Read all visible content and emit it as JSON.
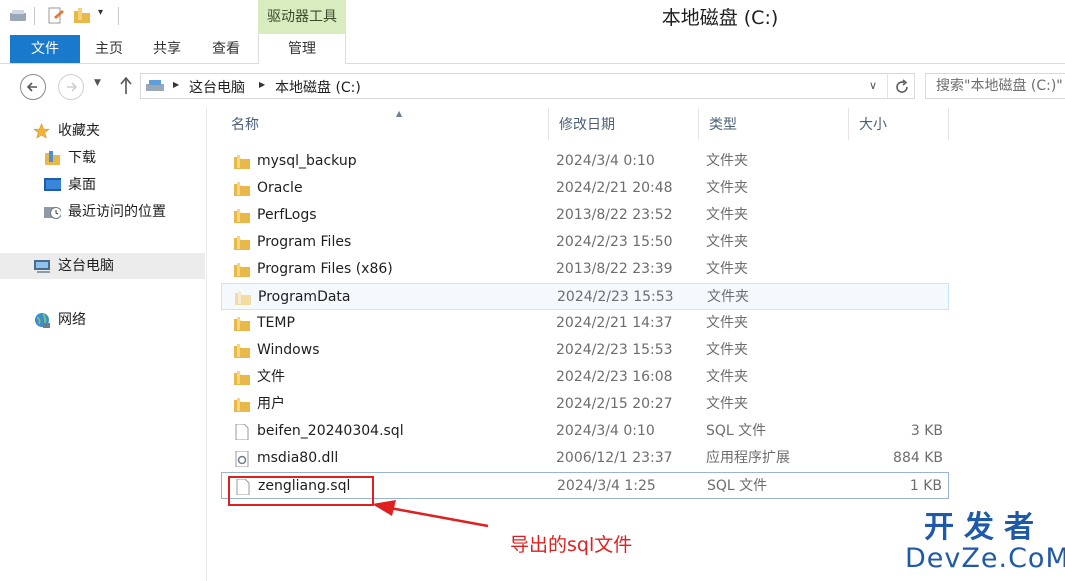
{
  "window": {
    "title": "本地磁盘 (C:)",
    "contextual_tab_group": "驱动器工具"
  },
  "ribbon": {
    "tabs": {
      "file": "文件",
      "home": "主页",
      "share": "共享",
      "view": "查看",
      "manage": "管理"
    }
  },
  "address": {
    "crumbs": [
      "这台电脑",
      "本地磁盘 (C:)"
    ],
    "search_placeholder": "搜索\"本地磁盘 (C:)\""
  },
  "nav": {
    "favorites": "收藏夹",
    "downloads": "下载",
    "desktop": "桌面",
    "recent": "最近访问的位置",
    "this_pc": "这台电脑",
    "network": "网络"
  },
  "columns": {
    "name": "名称",
    "modified": "修改日期",
    "type": "类型",
    "size": "大小"
  },
  "files": [
    {
      "name": "mysql_backup",
      "date": "2024/3/4 0:10",
      "type": "文件夹",
      "size": "",
      "icon": "folder"
    },
    {
      "name": "Oracle",
      "date": "2024/2/21 20:48",
      "type": "文件夹",
      "size": "",
      "icon": "folder"
    },
    {
      "name": "PerfLogs",
      "date": "2013/8/22 23:52",
      "type": "文件夹",
      "size": "",
      "icon": "folder"
    },
    {
      "name": "Program Files",
      "date": "2024/2/23 15:50",
      "type": "文件夹",
      "size": "",
      "icon": "folder"
    },
    {
      "name": "Program Files (x86)",
      "date": "2013/8/22 23:39",
      "type": "文件夹",
      "size": "",
      "icon": "folder"
    },
    {
      "name": "ProgramData",
      "date": "2024/2/23 15:53",
      "type": "文件夹",
      "size": "",
      "icon": "folder-faded"
    },
    {
      "name": "TEMP",
      "date": "2024/2/21 14:37",
      "type": "文件夹",
      "size": "",
      "icon": "folder"
    },
    {
      "name": "Windows",
      "date": "2024/2/23 15:53",
      "type": "文件夹",
      "size": "",
      "icon": "folder"
    },
    {
      "name": "文件",
      "date": "2024/2/23 16:08",
      "type": "文件夹",
      "size": "",
      "icon": "folder"
    },
    {
      "name": "用户",
      "date": "2024/2/15 20:27",
      "type": "文件夹",
      "size": "",
      "icon": "folder"
    },
    {
      "name": "beifen_20240304.sql",
      "date": "2024/3/4 0:10",
      "type": "SQL 文件",
      "size": "3 KB",
      "icon": "file"
    },
    {
      "name": "msdia80.dll",
      "date": "2006/12/1 23:37",
      "type": "应用程序扩展",
      "size": "884 KB",
      "icon": "dll"
    },
    {
      "name": "zengliang.sql",
      "date": "2024/3/4 1:25",
      "type": "SQL 文件",
      "size": "1 KB",
      "icon": "file"
    }
  ],
  "annotation": {
    "text": "导出的sql文件"
  },
  "watermark": {
    "line1": "开发者",
    "line2": "DevZe.CoM"
  },
  "colors": {
    "file_tab": "#1979ca",
    "contextual_tab": "#d8ecbf",
    "annotation": "#e02020",
    "watermark": "#1f5aa8",
    "folder": "#e8b94a"
  }
}
